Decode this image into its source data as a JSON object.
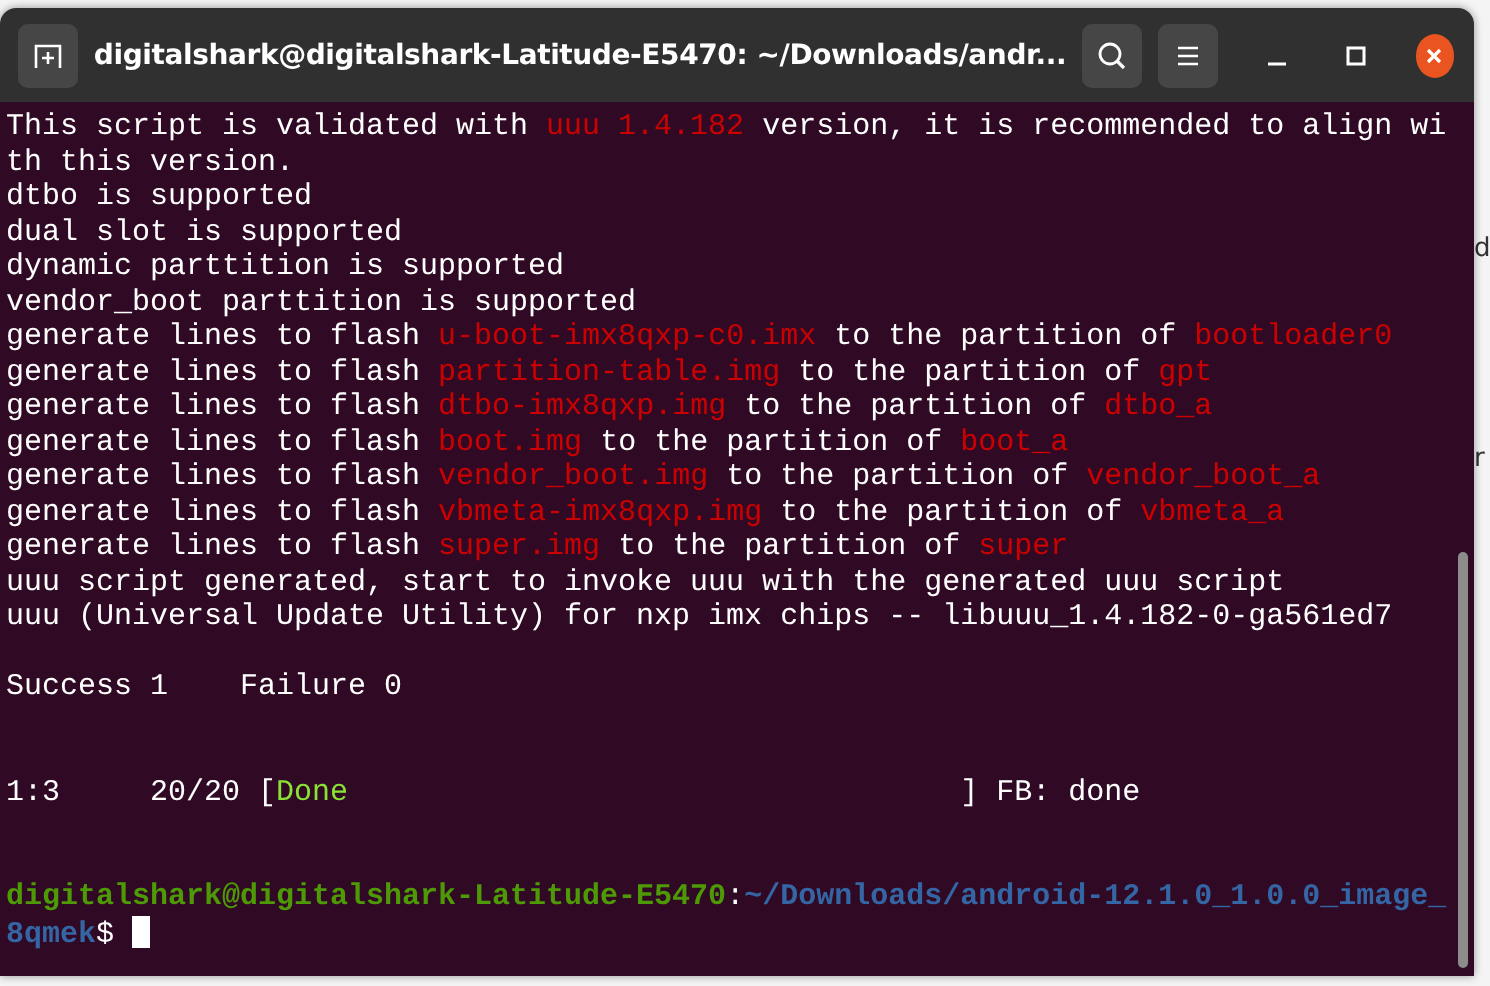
{
  "window": {
    "title": "digitalshark@digitalshark-Latitude-E5470: ~/Downloads/andr..."
  },
  "background_fragments": [
    "d",
    "r"
  ],
  "terminal_lines": [
    {
      "kind": "text",
      "segments": [
        {
          "text": "This script is validated with ",
          "kind": "default"
        },
        {
          "text": "uuu 1.4.182",
          "kind": "red"
        },
        {
          "text": " version, it is recommended to align wi",
          "kind": "default"
        }
      ]
    },
    {
      "kind": "text",
      "segments": [
        {
          "text": "th this version.",
          "kind": "default"
        }
      ]
    },
    {
      "kind": "text",
      "segments": [
        {
          "text": "dtbo is supported",
          "kind": "default"
        }
      ]
    },
    {
      "kind": "text",
      "segments": [
        {
          "text": "dual slot is supported",
          "kind": "default"
        }
      ]
    },
    {
      "kind": "text",
      "segments": [
        {
          "text": "dynamic parttition is supported",
          "kind": "default"
        }
      ]
    },
    {
      "kind": "text",
      "segments": [
        {
          "text": "vendor_boot parttition is supported",
          "kind": "default"
        }
      ]
    },
    {
      "kind": "text",
      "segments": [
        {
          "text": "generate lines to flash ",
          "kind": "default"
        },
        {
          "text": "u-boot-imx8qxp-c0.imx",
          "kind": "red"
        },
        {
          "text": " to the partition of ",
          "kind": "default"
        },
        {
          "text": "bootloader0",
          "kind": "red"
        }
      ]
    },
    {
      "kind": "text",
      "segments": [
        {
          "text": "generate lines to flash ",
          "kind": "default"
        },
        {
          "text": "partition-table.img",
          "kind": "red"
        },
        {
          "text": " to the partition of ",
          "kind": "default"
        },
        {
          "text": "gpt",
          "kind": "red"
        }
      ]
    },
    {
      "kind": "text",
      "segments": [
        {
          "text": "generate lines to flash ",
          "kind": "default"
        },
        {
          "text": "dtbo-imx8qxp.img",
          "kind": "red"
        },
        {
          "text": " to the partition of ",
          "kind": "default"
        },
        {
          "text": "dtbo_a",
          "kind": "red"
        }
      ]
    },
    {
      "kind": "text",
      "segments": [
        {
          "text": "generate lines to flash ",
          "kind": "default"
        },
        {
          "text": "boot.img",
          "kind": "red"
        },
        {
          "text": " to the partition of ",
          "kind": "default"
        },
        {
          "text": "boot_a",
          "kind": "red"
        }
      ]
    },
    {
      "kind": "text",
      "segments": [
        {
          "text": "generate lines to flash ",
          "kind": "default"
        },
        {
          "text": "vendor_boot.img",
          "kind": "red"
        },
        {
          "text": " to the partition of ",
          "kind": "default"
        },
        {
          "text": "vendor_boot_a",
          "kind": "red"
        }
      ]
    },
    {
      "kind": "text",
      "segments": [
        {
          "text": "generate lines to flash ",
          "kind": "default"
        },
        {
          "text": "vbmeta-imx8qxp.img",
          "kind": "red"
        },
        {
          "text": " to the partition of ",
          "kind": "default"
        },
        {
          "text": "vbmeta_a",
          "kind": "red"
        }
      ]
    },
    {
      "kind": "text",
      "segments": [
        {
          "text": "generate lines to flash ",
          "kind": "default"
        },
        {
          "text": "super.img",
          "kind": "red"
        },
        {
          "text": " to the partition of ",
          "kind": "default"
        },
        {
          "text": "super",
          "kind": "red"
        }
      ]
    },
    {
      "kind": "text",
      "segments": [
        {
          "text": "uuu script generated, start to invoke uuu with the generated uuu script",
          "kind": "default"
        }
      ]
    },
    {
      "kind": "text",
      "segments": [
        {
          "text": "uuu (Universal Update Utility) for nxp imx chips -- libuuu_1.4.182-0-ga561ed7",
          "kind": "default"
        }
      ]
    },
    {
      "kind": "blank"
    },
    {
      "kind": "text",
      "segments": [
        {
          "text": "Success 1    Failure 0",
          "kind": "default"
        }
      ]
    },
    {
      "kind": "blank"
    },
    {
      "kind": "blank"
    },
    {
      "kind": "text",
      "segments": [
        {
          "text": "1:3     20/20 [",
          "kind": "default"
        },
        {
          "text": "Done",
          "kind": "green"
        },
        {
          "text": "                                  ] FB: done",
          "kind": "default"
        }
      ]
    },
    {
      "kind": "blank"
    },
    {
      "kind": "blank"
    },
    {
      "kind": "text",
      "segments": [
        {
          "text": "digitalshark@digitalshark-Latitude-E5470",
          "kind": "prompt-green"
        },
        {
          "text": ":",
          "kind": "default"
        },
        {
          "text": "~/Downloads/android-12.1.0_1.0.0_image_",
          "kind": "blue"
        }
      ]
    },
    {
      "kind": "prompt",
      "segments": [
        {
          "text": "8qmek",
          "kind": "blue"
        },
        {
          "text": "$ ",
          "kind": "default"
        }
      ]
    }
  ]
}
